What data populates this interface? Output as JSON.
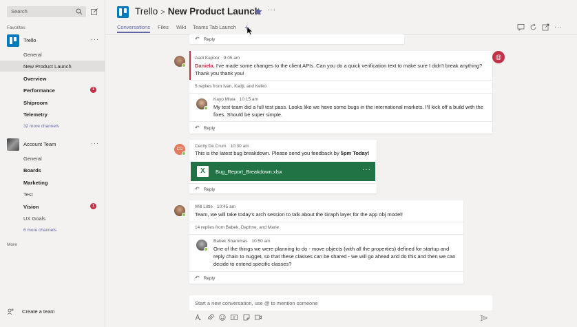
{
  "sidebar": {
    "search_placeholder": "Search",
    "favorites_label": "Favorites",
    "teams": [
      {
        "name": "Trello",
        "channels": [
          {
            "label": "General",
            "bold": false,
            "active": false
          },
          {
            "label": "New Product Launch",
            "bold": false,
            "active": true
          },
          {
            "label": "Overview",
            "bold": true,
            "active": false
          },
          {
            "label": "Performance",
            "bold": true,
            "active": false,
            "badge": "1"
          },
          {
            "label": "Shiproom",
            "bold": true,
            "active": false
          },
          {
            "label": "Telemetry",
            "bold": true,
            "active": false
          }
        ],
        "more_channels": "32 more channels"
      },
      {
        "name": "Account Team",
        "channels": [
          {
            "label": "General",
            "bold": false
          },
          {
            "label": "Boards",
            "bold": true
          },
          {
            "label": "Marketing",
            "bold": true
          },
          {
            "label": "Test",
            "bold": false
          },
          {
            "label": "Vision",
            "bold": true,
            "badge": "1"
          },
          {
            "label": "UX Goals",
            "bold": false
          }
        ],
        "more_channels": "6 more channels"
      }
    ],
    "more_label": "More",
    "create_team_label": "Create a team"
  },
  "header": {
    "team": "Trello",
    "channel": "New Product Launch",
    "tabs": [
      "Conversations",
      "Files",
      "Wiki",
      "Teams Tab Launch"
    ],
    "plus": "+"
  },
  "conversation": {
    "reply_label": "Reply",
    "threads": [
      {
        "author": "Aadi Kapoor",
        "time": "9:05 am",
        "mention": "Daniela",
        "text": ", I've made some changes to the client APIs. Can you do a quick verification text to make sure I didn't break anything? Thank you thank you!",
        "replies_summary": "5 replies from Ivan, Kadji, and Keiko",
        "reply": {
          "author": "Kayo Miwa",
          "time": "10:15 am",
          "text": "My test team did a full test pass. Looks like we have some bugs in the international markets. I'll kick off a build with the fixes. Should be super simple."
        }
      },
      {
        "author": "Cecily De Crum",
        "initials": "CD",
        "time": "10:30 am",
        "text": "This is the latest bug breakdown. Please send you feedback by ",
        "text_bold": "5pm Today!",
        "file": "Bug_Report_Breakdown.xlsx"
      },
      {
        "author": "Will Little",
        "time": "10:45 am",
        "text": "Team, we will take today's arch session to talk about the Graph layer for the app obj model!",
        "replies_summary": "14 replies from Babek, Daphne, and Marie",
        "reply": {
          "author": "Babek Shammas",
          "time": "10:50 am",
          "text": "One of the things we were planning to do - move objects (with all the properties) defined for startup and reply chain to nugget, so that these classes can be shared - we will go ahead and do this and then we can decide to extend specific classes?"
        }
      }
    ]
  },
  "composer": {
    "placeholder": "Start a new conversation, use @ to mention someone"
  },
  "colors": {
    "accent": "#6264a7",
    "trello": "#0079bf",
    "excel": "#217346",
    "alert": "#c4314b"
  }
}
